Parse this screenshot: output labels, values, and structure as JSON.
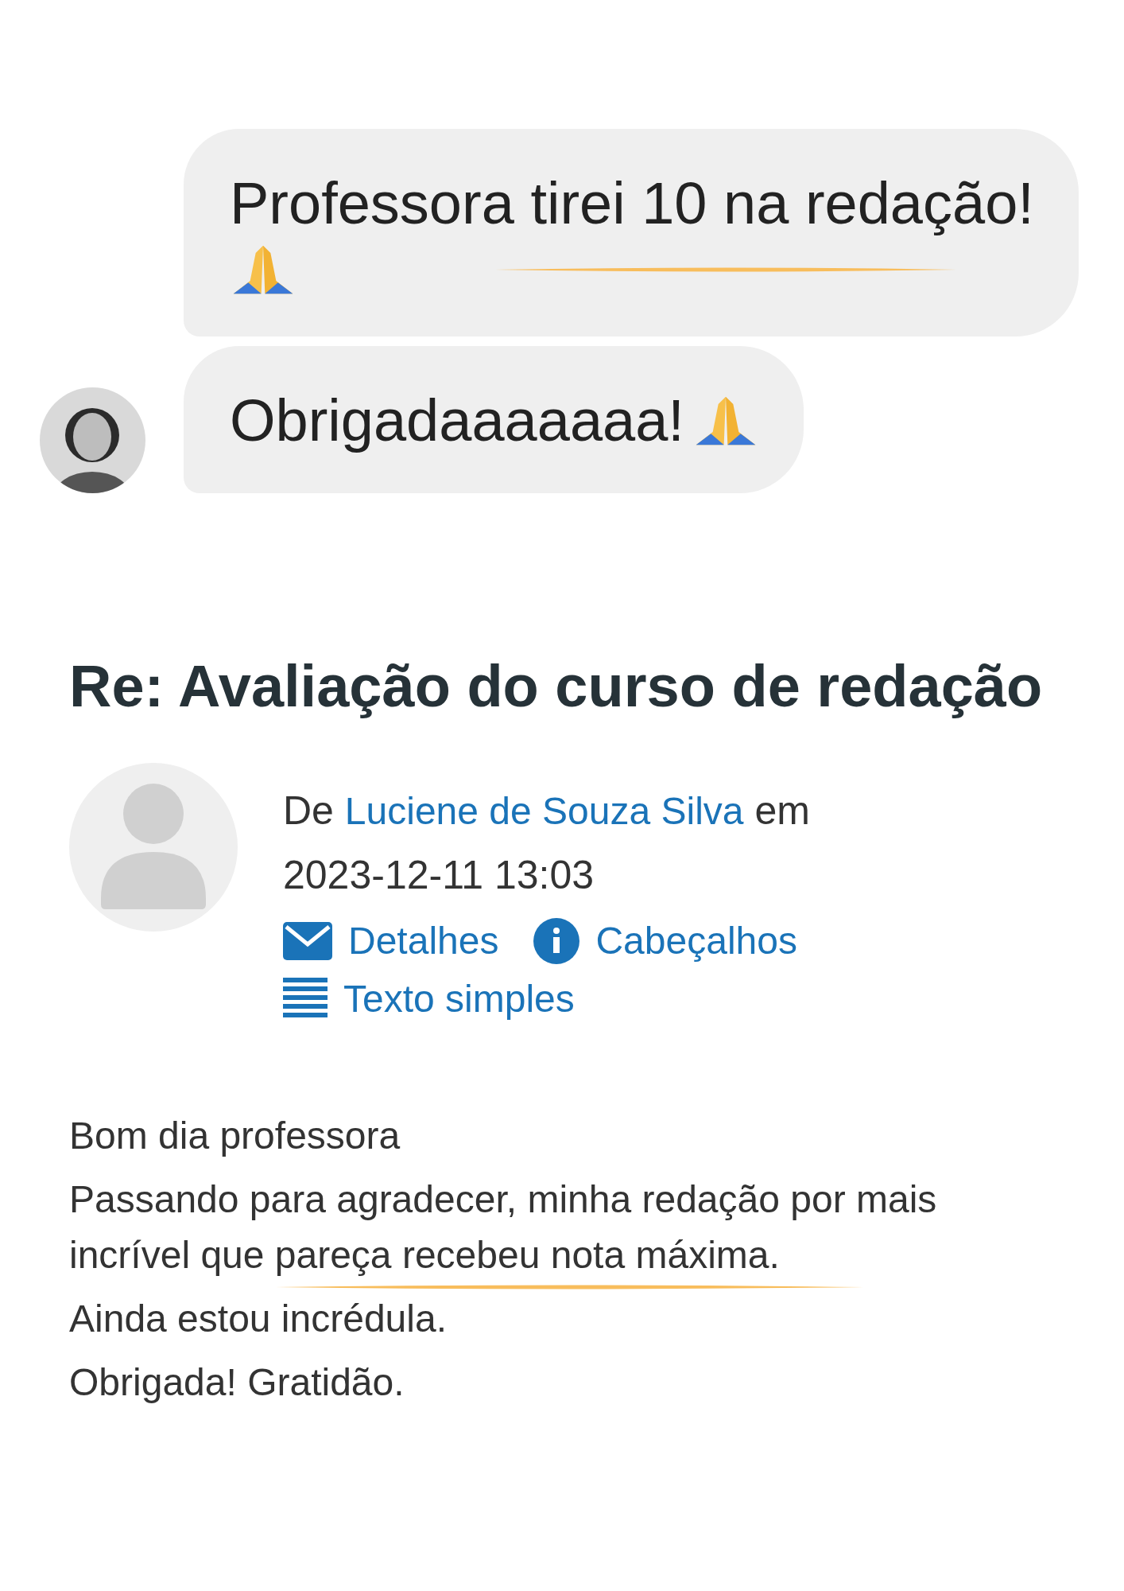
{
  "chat": {
    "messages": [
      {
        "text": "Professora tirei 10 na redação!",
        "emoji": true,
        "highlighted": true,
        "avatar": false
      },
      {
        "text": "Obrigadaaaaaaa!",
        "emoji": true,
        "highlighted": false,
        "avatar": true
      }
    ]
  },
  "post": {
    "title": "Re: Avaliação do curso de redação",
    "by": "De",
    "author": "Luciene de Souza Silva",
    "on": "em",
    "date": "2023-12-11 13:03",
    "actions": [
      {
        "label": "Detalhes",
        "kind": "envelope"
      },
      {
        "label": "Cabeçalhos",
        "kind": "info"
      },
      {
        "label": "Texto simples",
        "kind": "list"
      }
    ],
    "body": [
      {
        "text": "Bom dia professora",
        "highlighted": false
      },
      {
        "text": "Passando para agradecer, minha redação por mais incrível que pareça recebeu nota máxima.",
        "highlighted": true
      },
      {
        "text": "Ainda estou incrédula.",
        "highlighted": false
      },
      {
        "text": "Obrigada! Gratidão.",
        "highlighted": false
      }
    ]
  }
}
